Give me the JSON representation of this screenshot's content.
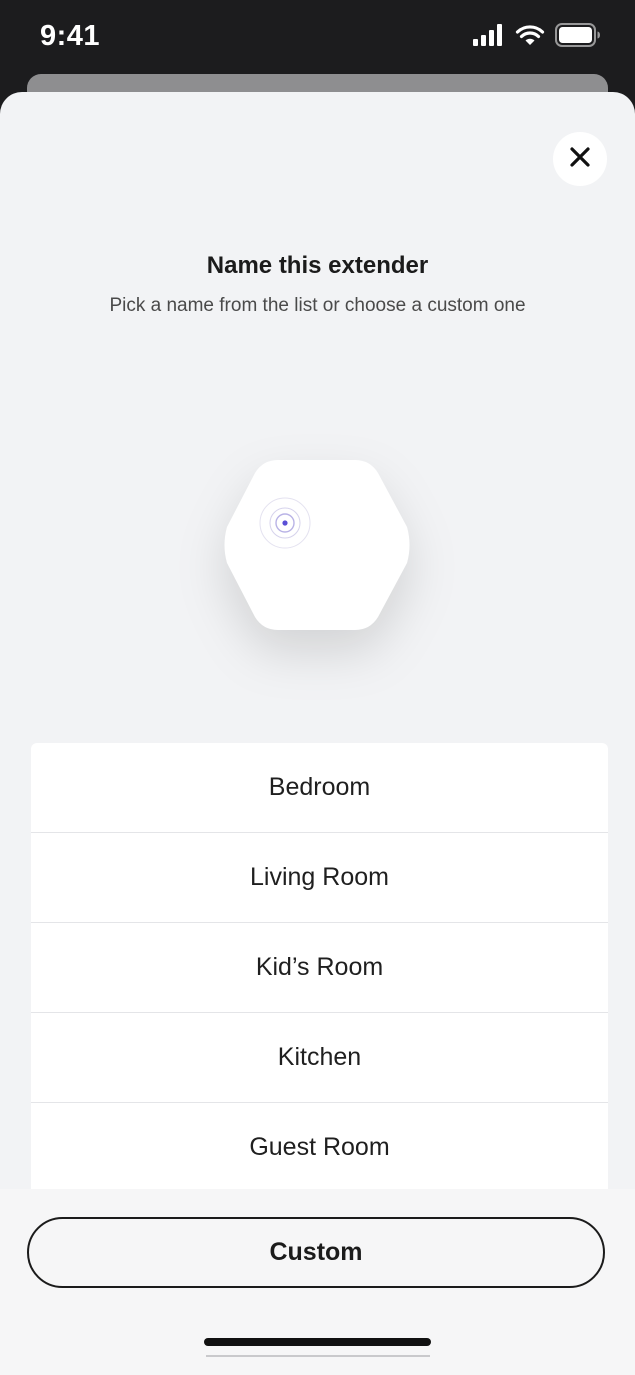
{
  "status_bar": {
    "time": "9:41",
    "icons": [
      "cellular-signal-icon",
      "wifi-icon",
      "battery-icon"
    ]
  },
  "header": {
    "close_icon": "close-icon",
    "title": "Name this extender",
    "subtitle": "Pick a name from the list or choose a custom one"
  },
  "device_illustration": {
    "icon": "extender-device-icon",
    "accent_color": "#5a4fd6"
  },
  "names": [
    "Bedroom",
    "Living Room",
    "Kid’s Room",
    "Kitchen",
    "Guest Room"
  ],
  "footer": {
    "custom_label": "Custom"
  }
}
